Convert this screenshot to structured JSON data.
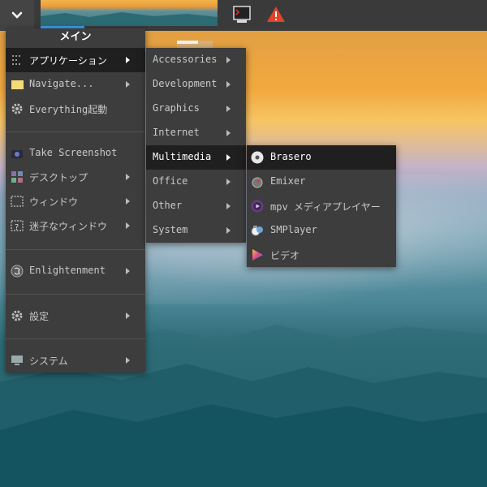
{
  "topbar": {
    "menu_icon": "chevron-down-icon",
    "desktop_preview": "desktop-pager",
    "tray": [
      "terminal-icon",
      "warning-icon"
    ]
  },
  "main_menu": {
    "title": "メイン",
    "items": [
      {
        "label": "アプリケーション",
        "icon": "applications-icon",
        "submenu": true,
        "highlighted": true
      },
      {
        "label": "Navigate...",
        "icon": "folder-icon",
        "submenu": true
      },
      {
        "label": "Everything起動",
        "icon": "gear-icon",
        "submenu": false
      },
      {
        "label": "Take Screenshot",
        "icon": "camera-icon",
        "submenu": false
      },
      {
        "label": "デスクトップ",
        "icon": "desktop-icon",
        "submenu": true
      },
      {
        "label": "ウィンドウ",
        "icon": "window-icon",
        "submenu": true
      },
      {
        "label": "迷子なウィンドウ",
        "icon": "lost-window-icon",
        "submenu": true
      },
      {
        "label": "Enlightenment",
        "icon": "enlightenment-icon",
        "submenu": true
      },
      {
        "label": "設定",
        "icon": "gear-icon",
        "submenu": true
      },
      {
        "label": "システム",
        "icon": "monitor-icon",
        "submenu": true
      }
    ]
  },
  "categories_menu": {
    "items": [
      {
        "label": "Accessories"
      },
      {
        "label": "Development"
      },
      {
        "label": "Graphics"
      },
      {
        "label": "Internet"
      },
      {
        "label": "Multimedia",
        "highlighted": true
      },
      {
        "label": "Office"
      },
      {
        "label": "Other"
      },
      {
        "label": "System"
      }
    ]
  },
  "multimedia_menu": {
    "items": [
      {
        "label": "Brasero",
        "icon": "disc-icon",
        "highlighted": true
      },
      {
        "label": "Emixer",
        "icon": "mixer-icon"
      },
      {
        "label": "mpv メディアプレイヤー",
        "icon": "mpv-icon"
      },
      {
        "label": "SMPlayer",
        "icon": "smplayer-icon"
      },
      {
        "label": "ビデオ",
        "icon": "video-play-icon"
      }
    ]
  },
  "colors": {
    "menu_bg": "#3d3d3d",
    "highlight_bg": "#1f1f1f",
    "topbar_bg": "#3a3a3a",
    "accent": "#3d9be8"
  }
}
